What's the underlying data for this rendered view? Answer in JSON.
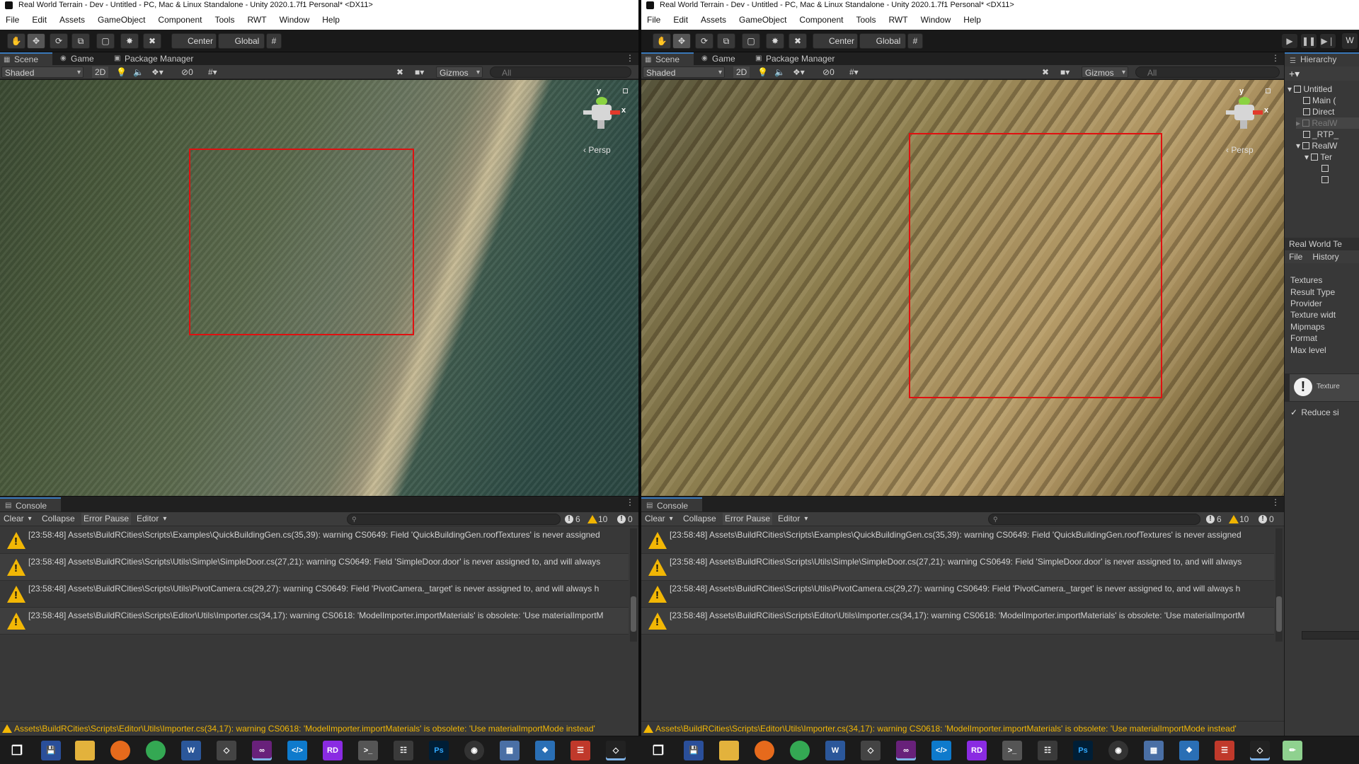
{
  "left_window": {
    "title": "Real World Terrain - Dev - Untitled - PC, Mac & Linux Standalone - Unity 2020.1.7f1 Personal* <DX11>",
    "menu": [
      "File",
      "Edit",
      "Assets",
      "GameObject",
      "Component",
      "Tools",
      "RWT",
      "Window",
      "Help"
    ],
    "toolbar": {
      "pivot": "Center",
      "rotation": "Global"
    },
    "tabs": [
      "Scene",
      "Game",
      "Package Manager"
    ],
    "scene_options": {
      "draw_mode": "Shaded",
      "mode_2d": "2D",
      "hidden_count": "0",
      "gizmos": "Gizmos",
      "search_placeholder": "All"
    },
    "persp": "Persp",
    "gizmo": {
      "y": "y",
      "x": "x"
    },
    "console": {
      "tab": "Console",
      "clear": "Clear",
      "collapse": "Collapse",
      "error_pause": "Error Pause",
      "editor": "Editor",
      "counts": {
        "info": "6",
        "warnings": "10",
        "errors": "0"
      },
      "messages": [
        "[23:58:48] Assets\\BuildRCities\\Scripts\\Examples\\QuickBuildingGen.cs(35,39): warning CS0649: Field 'QuickBuildingGen.roofTextures' is never assigned",
        "[23:58:48] Assets\\BuildRCities\\Scripts\\Utils\\Simple\\SimpleDoor.cs(27,21): warning CS0649: Field 'SimpleDoor.door' is never assigned to, and will always",
        "[23:58:48] Assets\\BuildRCities\\Scripts\\Utils\\PivotCamera.cs(29,27): warning CS0649: Field 'PivotCamera._target' is never assigned to, and will always h",
        "[23:58:48] Assets\\BuildRCities\\Scripts\\Editor\\Utils\\Importer.cs(34,17): warning CS0618: 'ModelImporter.importMaterials' is obsolete: 'Use materialImportM"
      ]
    },
    "status": "Assets\\BuildRCities\\Scripts\\Editor\\Utils\\Importer.cs(34,17): warning CS0618: 'ModelImporter.importMaterials' is obsolete: 'Use materialImportMode instead'"
  },
  "right_window": {
    "title": "Real World Terrain - Dev - Untitled - PC, Mac & Linux Standalone - Unity 2020.1.7f1 Personal* <DX11>",
    "menu": [
      "File",
      "Edit",
      "Assets",
      "GameObject",
      "Component",
      "Tools",
      "RWT",
      "Window",
      "Help"
    ],
    "toolbar": {
      "pivot": "Center",
      "rotation": "Global",
      "layout_letter": "W"
    },
    "tabs": [
      "Scene",
      "Game",
      "Package Manager"
    ],
    "scene_options": {
      "draw_mode": "Shaded",
      "mode_2d": "2D",
      "hidden_count": "0",
      "gizmos": "Gizmos",
      "search_placeholder": "All"
    },
    "persp": "Persp",
    "gizmo": {
      "y": "y",
      "x": "x"
    },
    "console": {
      "tab": "Console",
      "clear": "Clear",
      "collapse": "Collapse",
      "error_pause": "Error Pause",
      "editor": "Editor",
      "counts": {
        "info": "6",
        "warnings": "10",
        "errors": "0"
      },
      "messages": [
        "[23:58:48] Assets\\BuildRCities\\Scripts\\Examples\\QuickBuildingGen.cs(35,39): warning CS0649: Field 'QuickBuildingGen.roofTextures' is never assigned",
        "[23:58:48] Assets\\BuildRCities\\Scripts\\Utils\\Simple\\SimpleDoor.cs(27,21): warning CS0649: Field 'SimpleDoor.door' is never assigned to, and will always",
        "[23:58:48] Assets\\BuildRCities\\Scripts\\Utils\\PivotCamera.cs(29,27): warning CS0649: Field 'PivotCamera._target' is never assigned to, and will always h",
        "[23:58:48] Assets\\BuildRCities\\Scripts\\Editor\\Utils\\Importer.cs(34,17): warning CS0618: 'ModelImporter.importMaterials' is obsolete: 'Use materialImportM"
      ]
    },
    "status": "Assets\\BuildRCities\\Scripts\\Editor\\Utils\\Importer.cs(34,17): warning CS0618: 'ModelImporter.importMaterials' is obsolete: 'Use materialImportMode instead'",
    "hierarchy": {
      "tab": "Hierarchy",
      "items": [
        "Untitled",
        "Main (",
        "Direct",
        "RealW",
        "_RTP_",
        "RealW",
        "Ter"
      ]
    },
    "rwt_panel": {
      "title": "Real World Te",
      "menu": [
        "File",
        "History"
      ],
      "props": [
        "Textures",
        "Result Type",
        "Provider",
        "Texture widt",
        "Mipmaps",
        "Format",
        "Max level"
      ],
      "info": "Texture",
      "reduce": "Reduce si"
    }
  },
  "colors": {
    "accent": "#3a79bb",
    "warning": "#f2b705",
    "highlight_box": "#e01010"
  },
  "taskbar": {
    "icons": [
      "windows-start",
      "save",
      "file-explorer",
      "firefox",
      "chrome",
      "word",
      "unity",
      "visual-studio",
      "vscode",
      "jetbrains-rider",
      "terminal",
      "git",
      "photoshop",
      "obs",
      "calculator",
      "network",
      "filezilla",
      "unity-hub"
    ]
  }
}
